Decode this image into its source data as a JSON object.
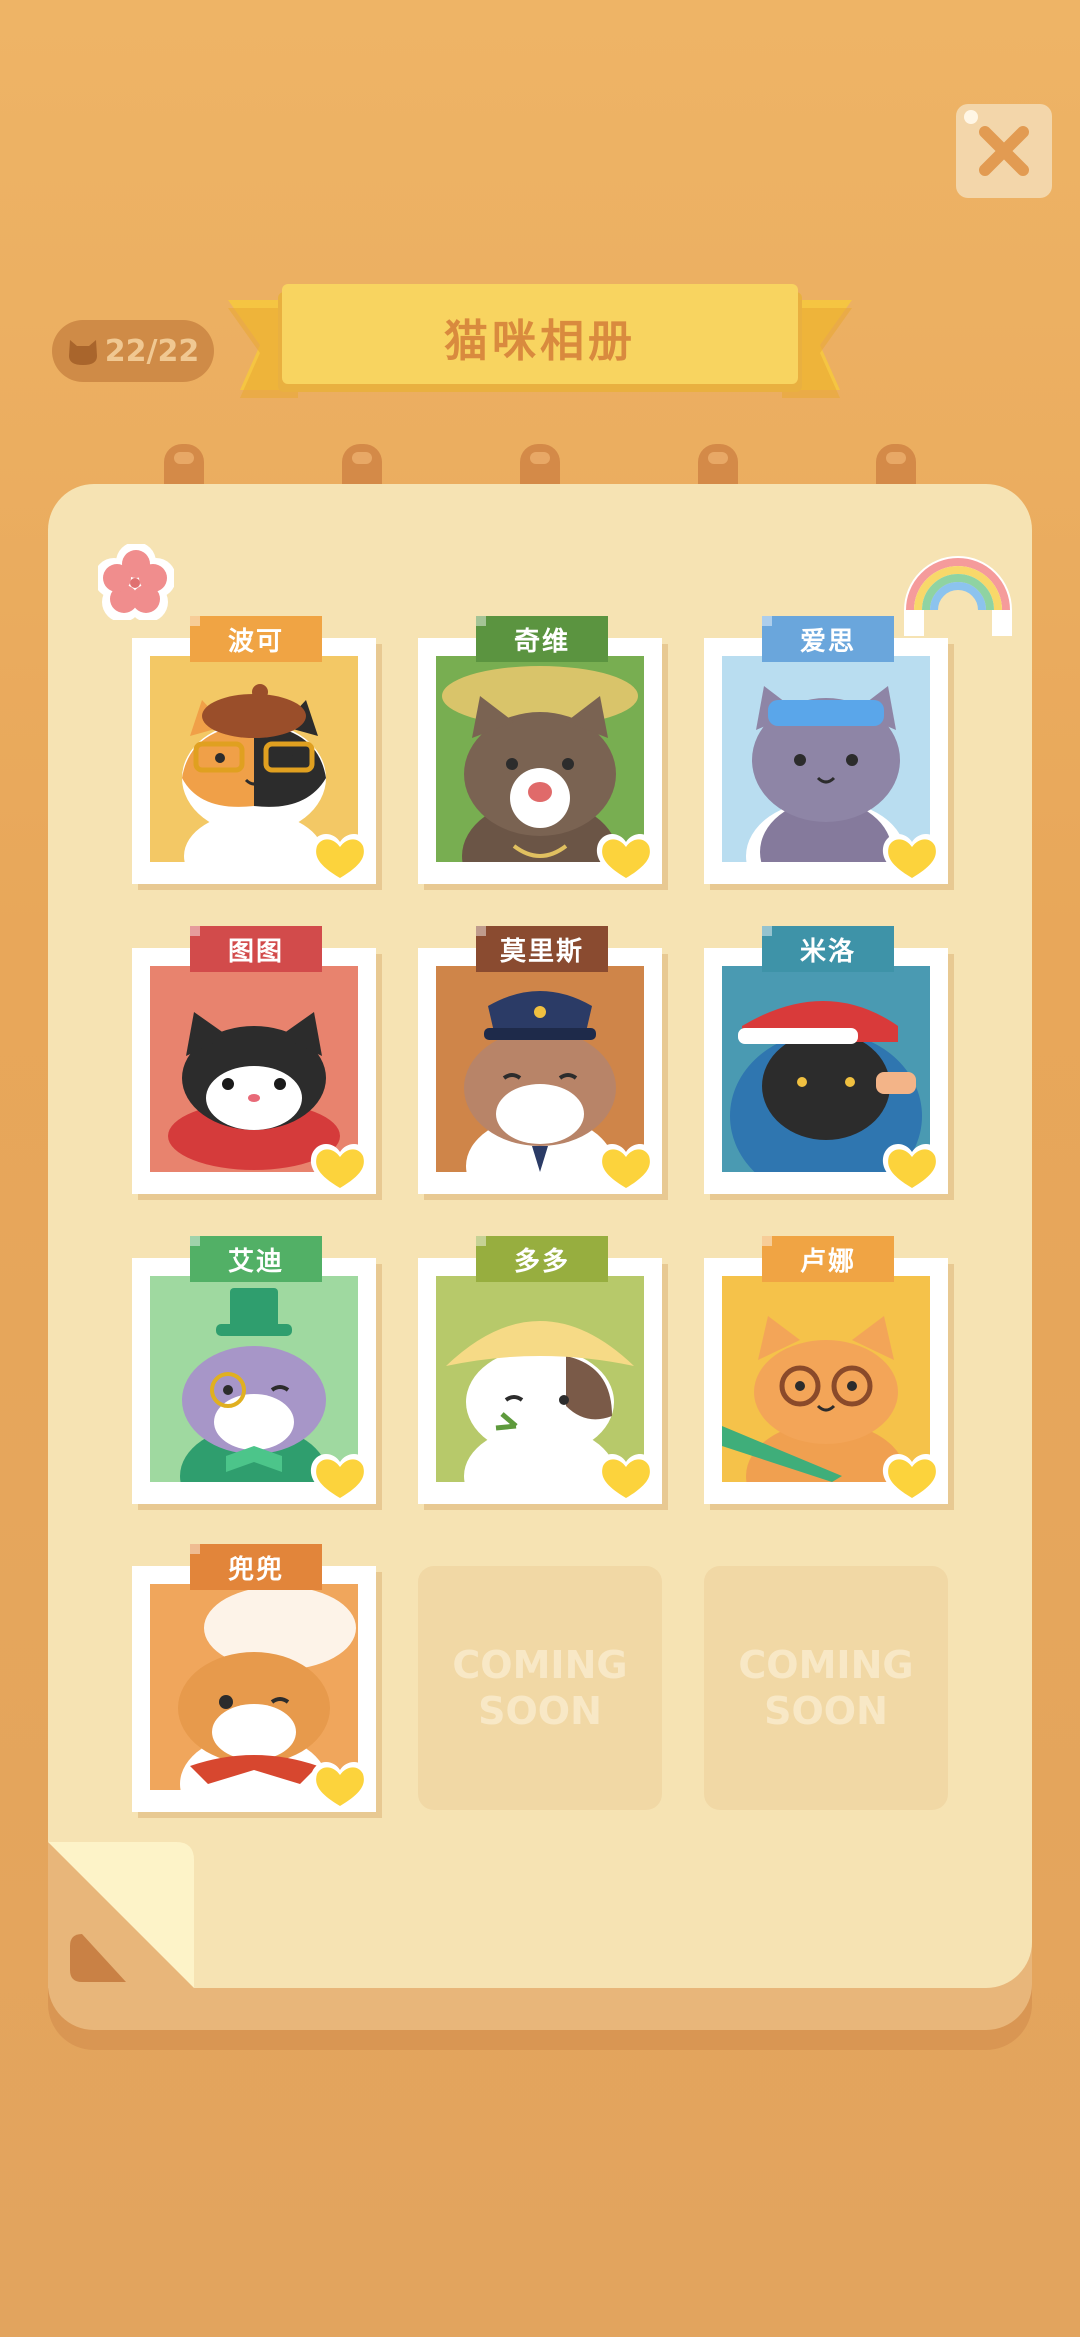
{
  "close_icon": "close-x-icon",
  "counter": {
    "icon": "cat-head-icon",
    "text": "22/22"
  },
  "title": "猫咪相册",
  "cats": [
    {
      "name": "波可",
      "tag_color": "#F0A444",
      "bg": "#F3C865"
    },
    {
      "name": "奇维",
      "tag_color": "#5B9440",
      "bg": "#78AE51"
    },
    {
      "name": "爱思",
      "tag_color": "#6AA6DC",
      "bg": "#B9DDF0"
    },
    {
      "name": "图图",
      "tag_color": "#D24B4B",
      "bg": "#E8836E"
    },
    {
      "name": "莫里斯",
      "tag_color": "#8A4B30",
      "bg": "#CF8549"
    },
    {
      "name": "米洛",
      "tag_color": "#3E93A8",
      "bg": "#4A9AB2"
    },
    {
      "name": "艾迪",
      "tag_color": "#52B066",
      "bg": "#9FD9A0"
    },
    {
      "name": "多多",
      "tag_color": "#97AE3F",
      "bg": "#B7C96A"
    },
    {
      "name": "卢娜",
      "tag_color": "#F0A444",
      "bg": "#F5C24A"
    },
    {
      "name": "兜兜",
      "tag_color": "#E2853A",
      "bg": "#F0A65C"
    }
  ],
  "coming_soon": [
    {
      "line1": "COMING",
      "line2": "SOON"
    },
    {
      "line1": "COMING",
      "line2": "SOON"
    }
  ]
}
